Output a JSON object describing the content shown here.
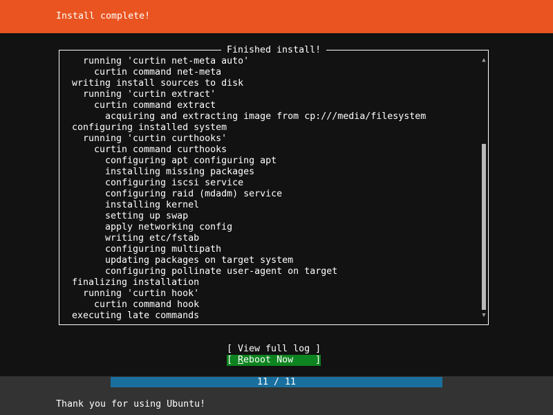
{
  "header": {
    "title": "Install complete!"
  },
  "log_panel": {
    "title": "Finished install!",
    "scroll_up_icon": "▲",
    "scroll_down_icon": "▼",
    "lines": [
      {
        "indent": 1,
        "text": "running 'curtin net-meta auto'"
      },
      {
        "indent": 2,
        "text": "curtin command net-meta"
      },
      {
        "indent": 0,
        "text": "writing install sources to disk"
      },
      {
        "indent": 1,
        "text": "running 'curtin extract'"
      },
      {
        "indent": 2,
        "text": "curtin command extract"
      },
      {
        "indent": 3,
        "text": "acquiring and extracting image from cp:///media/filesystem"
      },
      {
        "indent": 0,
        "text": "configuring installed system"
      },
      {
        "indent": 1,
        "text": "running 'curtin curthooks'"
      },
      {
        "indent": 2,
        "text": "curtin command curthooks"
      },
      {
        "indent": 3,
        "text": "configuring apt configuring apt"
      },
      {
        "indent": 3,
        "text": "installing missing packages"
      },
      {
        "indent": 3,
        "text": "configuring iscsi service"
      },
      {
        "indent": 3,
        "text": "configuring raid (mdadm) service"
      },
      {
        "indent": 3,
        "text": "installing kernel"
      },
      {
        "indent": 3,
        "text": "setting up swap"
      },
      {
        "indent": 3,
        "text": "apply networking config"
      },
      {
        "indent": 3,
        "text": "writing etc/fstab"
      },
      {
        "indent": 3,
        "text": "configuring multipath"
      },
      {
        "indent": 3,
        "text": "updating packages on target system"
      },
      {
        "indent": 3,
        "text": "configuring pollinate user-agent on target"
      },
      {
        "indent": 0,
        "text": "finalizing installation"
      },
      {
        "indent": 1,
        "text": "running 'curtin hook'"
      },
      {
        "indent": 2,
        "text": "curtin command hook"
      },
      {
        "indent": 0,
        "text": "executing late commands"
      }
    ]
  },
  "buttons": {
    "view_log": {
      "open": "[ ",
      "hotkey": "",
      "rest": "View full log",
      "close": " ]"
    },
    "reboot": {
      "open": "[ ",
      "hotkey": "R",
      "rest": "eboot Now    ",
      "close": "]"
    }
  },
  "progress": {
    "current": 11,
    "total": 11,
    "label": "11 / 11"
  },
  "footer": {
    "message": "Thank you for using Ubuntu!"
  },
  "colors": {
    "accent": "#e95420",
    "button_focus": "#0e8420",
    "progress_fill": "#19709f",
    "background": "#121212",
    "footer_bg": "#333333"
  }
}
